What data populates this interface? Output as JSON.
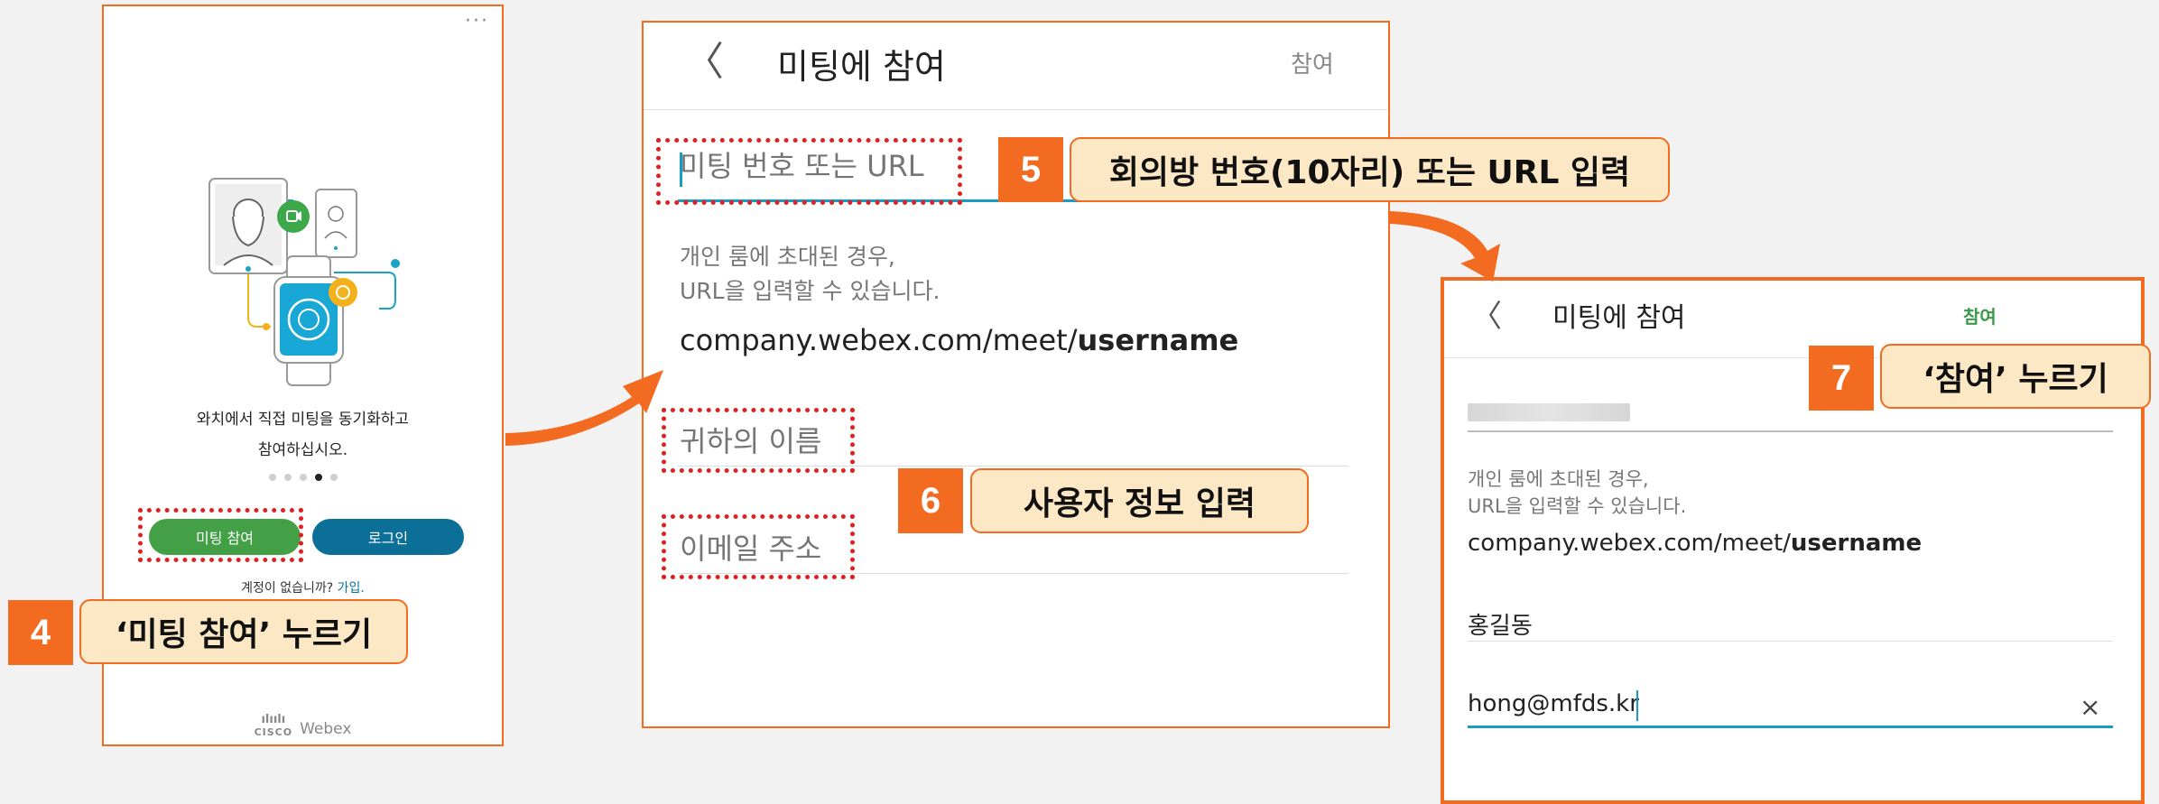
{
  "phone1": {
    "menu": "···",
    "description_line1": "와치에서 직접 미팅을 동기화하고",
    "description_line2": "참여하십시오.",
    "page_dots": 5,
    "page_active": 4,
    "join_button": "미팅 참여",
    "login_button": "로그인",
    "signup_prompt": "계정이 없습니까?",
    "signup_link": "가입.",
    "cisco_bars": "ılıılı",
    "cisco_text": "CISCO",
    "webex_text": "Webex"
  },
  "phone2": {
    "title": "미팅에 참여",
    "back": "〈",
    "action": "참여",
    "url_placeholder": "미팅 번호 또는 URL",
    "help_line1": "개인 룸에 초대된 경우,",
    "help_line2": "URL을 입력할 수 있습니다.",
    "url_example_prefix": "company.webex.com/meet/",
    "url_example_user": "username",
    "name_placeholder": "귀하의 이름",
    "email_placeholder": "이메일 주소"
  },
  "phone3": {
    "title": "미팅에 참여",
    "back": "〈",
    "action": "참여",
    "help_line1": "개인 룸에 초대된 경우,",
    "help_line2": "URL을 입력할 수 있습니다.",
    "url_example_prefix": "company.webex.com/meet/",
    "url_example_user": "username",
    "name_value": "홍길동",
    "email_value": "hong@mfds.kr",
    "clear": "×"
  },
  "steps": [
    {
      "number": "4",
      "label": "‘미팅 참여’ 누르기"
    },
    {
      "number": "5",
      "label": "회의방 번호(10자리) 또는 URL 입력"
    },
    {
      "number": "6",
      "label": "사용자 정보 입력"
    },
    {
      "number": "7",
      "label": "‘참여’ 누르기"
    }
  ],
  "colors": {
    "accent_orange": "#f26b21",
    "highlight_red": "#e02020",
    "label_fill": "#fde8c6",
    "join_green": "#43a047",
    "login_blue": "#0b6f98",
    "input_blue": "#1a9bc4"
  }
}
